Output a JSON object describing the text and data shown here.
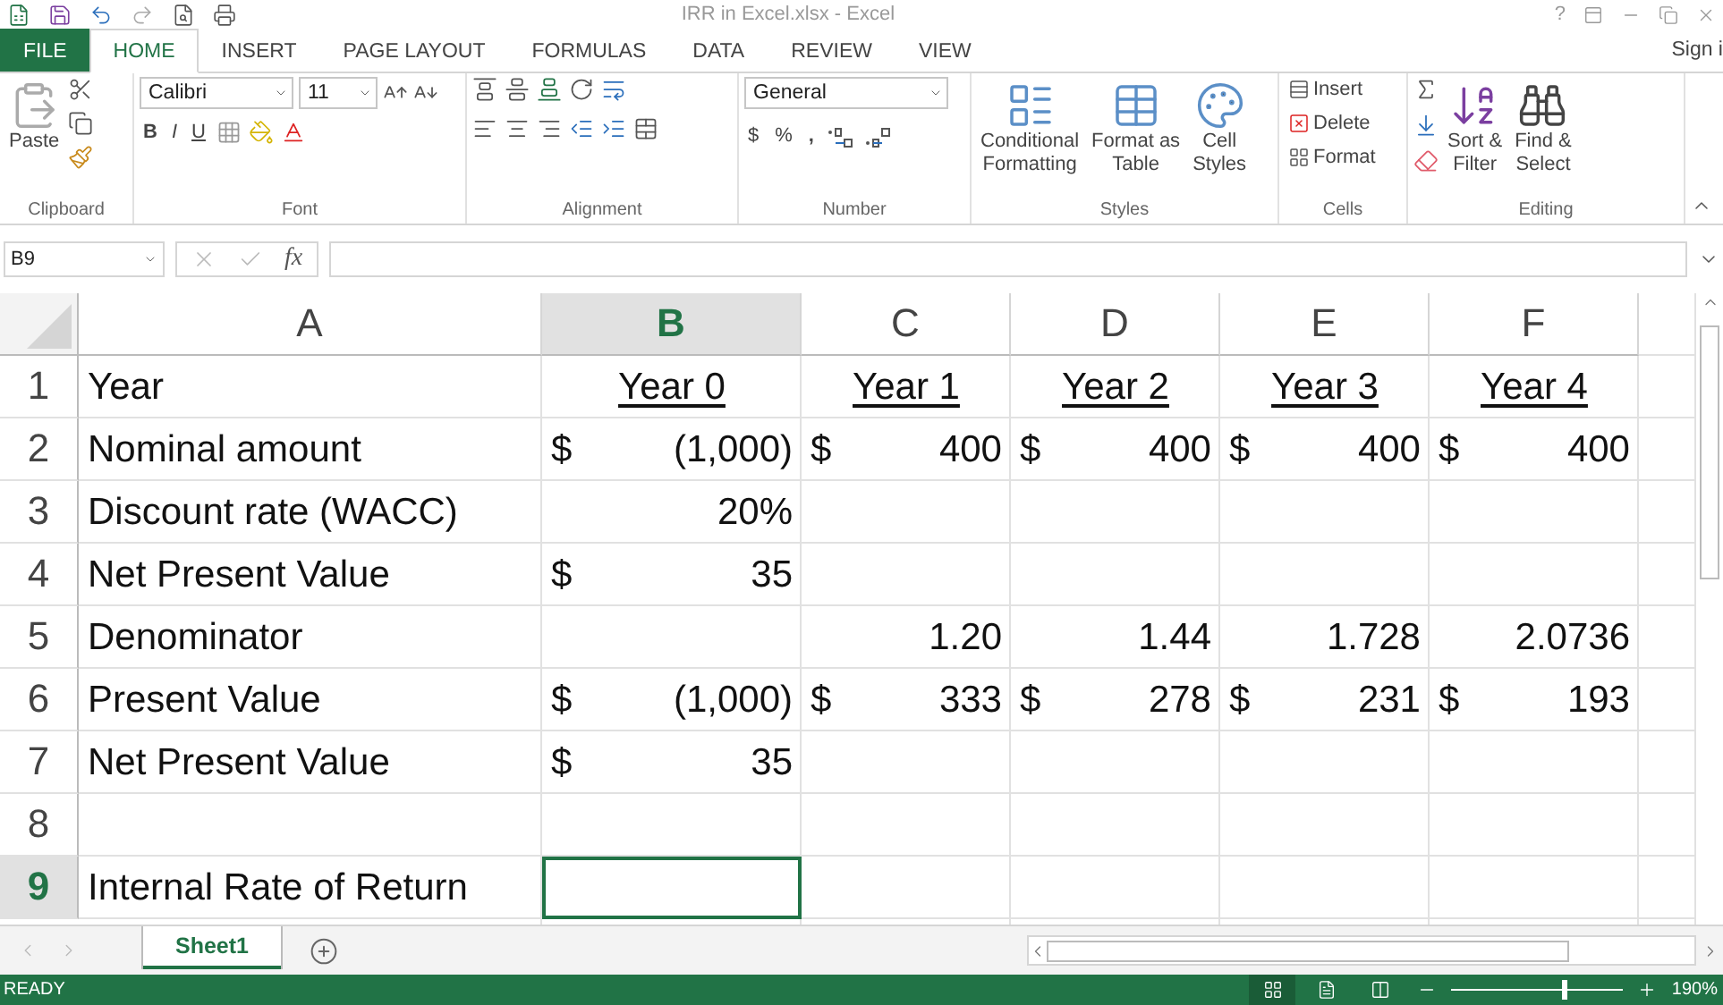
{
  "window": {
    "title": "IRR in Excel.xlsx - Excel",
    "help": "?"
  },
  "ribbon_tabs": [
    {
      "label": "FILE",
      "kind": "file",
      "selected": false
    },
    {
      "label": "HOME",
      "kind": "tab",
      "selected": true
    },
    {
      "label": "INSERT",
      "kind": "tab",
      "selected": false
    },
    {
      "label": "PAGE LAYOUT",
      "kind": "tab",
      "selected": false
    },
    {
      "label": "FORMULAS",
      "kind": "tab",
      "selected": false
    },
    {
      "label": "DATA",
      "kind": "tab",
      "selected": false
    },
    {
      "label": "REVIEW",
      "kind": "tab",
      "selected": false
    },
    {
      "label": "VIEW",
      "kind": "tab",
      "selected": false
    }
  ],
  "account": {
    "label": "Sign i"
  },
  "ribbon": {
    "clipboard": {
      "paste": "Paste",
      "label": "Clipboard"
    },
    "font": {
      "name": "Calibri",
      "size": "11",
      "bold": "B",
      "italic": "I",
      "underline": "U",
      "label": "Font"
    },
    "alignment": {
      "label": "Alignment"
    },
    "number": {
      "format": "General",
      "currency": "$",
      "percent": "%",
      "comma": ",",
      "label": "Number"
    },
    "styles": {
      "buttons": [
        {
          "lines": [
            "Conditional",
            "Formatting"
          ]
        },
        {
          "lines": [
            "Format as",
            "Table"
          ]
        },
        {
          "lines": [
            "Cell",
            "Styles"
          ]
        }
      ],
      "label": "Styles"
    },
    "cells": {
      "buttons": [
        "Insert",
        "Delete",
        "Format"
      ],
      "label": "Cells"
    },
    "editing": {
      "buttons": [
        {
          "lines": [
            "Sort &",
            "Filter"
          ]
        },
        {
          "lines": [
            "Find &",
            "Select"
          ]
        }
      ],
      "label": "Editing"
    }
  },
  "formula_bar": {
    "name_box": "B9",
    "fx": "fx"
  },
  "sheet": {
    "columns": [
      {
        "label": "A",
        "selected": false
      },
      {
        "label": "B",
        "selected": true
      },
      {
        "label": "C",
        "selected": false
      },
      {
        "label": "D",
        "selected": false
      },
      {
        "label": "E",
        "selected": false
      },
      {
        "label": "F",
        "selected": false
      }
    ],
    "rows": [
      {
        "number": "1",
        "selected": false,
        "cells": [
          {
            "kind": "label",
            "value": "Year"
          },
          {
            "kind": "heading",
            "value": "Year 0"
          },
          {
            "kind": "heading",
            "value": "Year 1"
          },
          {
            "kind": "heading",
            "value": "Year 2"
          },
          {
            "kind": "heading",
            "value": "Year 3"
          },
          {
            "kind": "heading",
            "value": "Year 4"
          }
        ]
      },
      {
        "number": "2",
        "selected": false,
        "cells": [
          {
            "kind": "label",
            "value": "Nominal amount"
          },
          {
            "kind": "accounting",
            "currency": "$",
            "value": "(1,000)"
          },
          {
            "kind": "accounting",
            "currency": "$",
            "value": "400"
          },
          {
            "kind": "accounting",
            "currency": "$",
            "value": "400"
          },
          {
            "kind": "accounting",
            "currency": "$",
            "value": "400"
          },
          {
            "kind": "accounting",
            "currency": "$",
            "value": "400"
          }
        ]
      },
      {
        "number": "3",
        "selected": false,
        "cells": [
          {
            "kind": "label",
            "value": "Discount rate (WACC)"
          },
          {
            "kind": "number",
            "value": "20%"
          },
          null,
          null,
          null,
          null
        ]
      },
      {
        "number": "4",
        "selected": false,
        "cells": [
          {
            "kind": "label",
            "value": "Net Present Value"
          },
          {
            "kind": "accounting",
            "currency": "$",
            "value": "35"
          },
          null,
          null,
          null,
          null
        ]
      },
      {
        "number": "5",
        "selected": false,
        "cells": [
          {
            "kind": "label",
            "value": "Denominator"
          },
          null,
          {
            "kind": "number",
            "value": "1.20"
          },
          {
            "kind": "number",
            "value": "1.44"
          },
          {
            "kind": "number",
            "value": "1.728"
          },
          {
            "kind": "number",
            "value": "2.0736"
          }
        ]
      },
      {
        "number": "6",
        "selected": false,
        "cells": [
          {
            "kind": "label",
            "value": "Present Value"
          },
          {
            "kind": "accounting",
            "currency": "$",
            "value": "(1,000)"
          },
          {
            "kind": "accounting",
            "currency": "$",
            "value": "333"
          },
          {
            "kind": "accounting",
            "currency": "$",
            "value": "278"
          },
          {
            "kind": "accounting",
            "currency": "$",
            "value": "231"
          },
          {
            "kind": "accounting",
            "currency": "$",
            "value": "193"
          }
        ]
      },
      {
        "number": "7",
        "selected": false,
        "cells": [
          {
            "kind": "label",
            "value": "Net Present Value"
          },
          {
            "kind": "accounting",
            "currency": "$",
            "value": "35"
          },
          null,
          null,
          null,
          null
        ]
      },
      {
        "number": "8",
        "selected": false,
        "cells": [
          null,
          null,
          null,
          null,
          null,
          null
        ]
      },
      {
        "number": "9",
        "selected": true,
        "cells": [
          {
            "kind": "label",
            "value": "Internal Rate of Return"
          },
          null,
          null,
          null,
          null,
          null
        ]
      }
    ]
  },
  "sheet_tabs": [
    {
      "label": "Sheet1",
      "selected": true
    }
  ],
  "status_bar": {
    "mode": "READY",
    "views": [
      {
        "kind": "normal",
        "selected": true
      },
      {
        "kind": "page_layout",
        "selected": false
      },
      {
        "kind": "page_break",
        "selected": false
      }
    ],
    "zoom": {
      "level": 0.65,
      "reading": "190%"
    }
  }
}
